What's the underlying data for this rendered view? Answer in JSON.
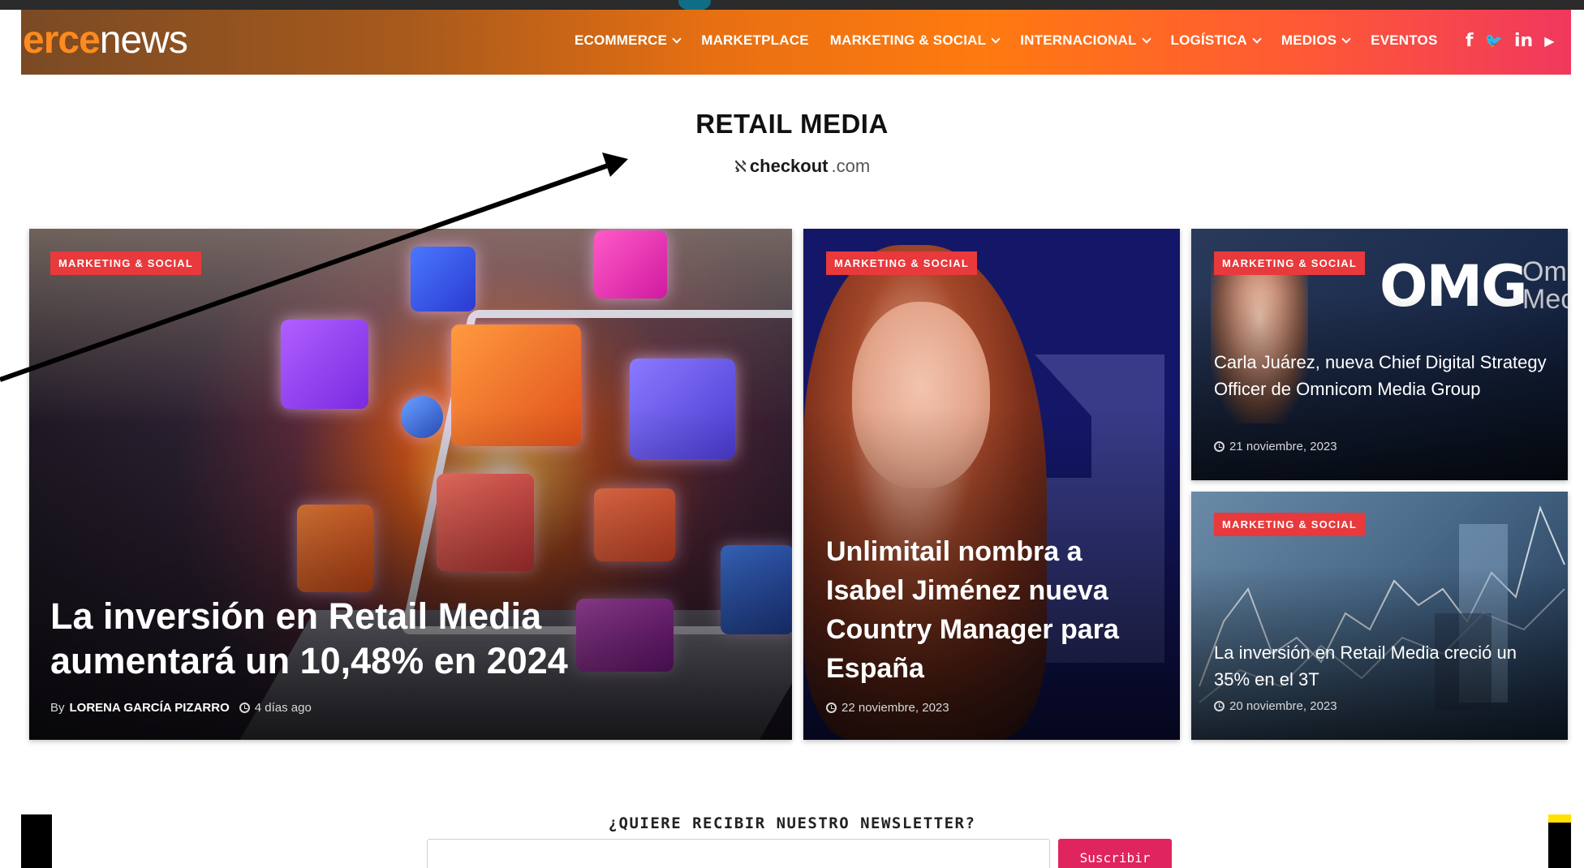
{
  "header": {
    "logo_part1": "erce",
    "logo_part2": "news",
    "nav": [
      {
        "label": "ECOMMERCE",
        "has_dropdown": true
      },
      {
        "label": "MARKETPLACE",
        "has_dropdown": false
      },
      {
        "label": "MARKETING & SOCIAL",
        "has_dropdown": true
      },
      {
        "label": "INTERNACIONAL",
        "has_dropdown": true
      },
      {
        "label": "LOGÍSTICA",
        "has_dropdown": true
      },
      {
        "label": "MEDIOS",
        "has_dropdown": true
      },
      {
        "label": "EVENTOS",
        "has_dropdown": false
      }
    ],
    "social_icons": [
      "facebook-icon",
      "twitter-icon",
      "linkedin-icon",
      "youtube-icon"
    ],
    "social_glyphs": [
      "f",
      "🐦",
      "in",
      "▶"
    ]
  },
  "section": {
    "title": "RETAIL MEDIA",
    "sponsor_brand": "checkout",
    "sponsor_domain": ".com"
  },
  "articles": [
    {
      "category": "MARKETING & SOCIAL",
      "title": "La inversión en Retail Media aumentará un 10,48% en 2024",
      "by_prefix": "By",
      "author": "LORENA GARCÍA PIZARRO",
      "date": "4 días ago"
    },
    {
      "category": "MARKETING & SOCIAL",
      "title": "Unlimitail nombra a Isabel Jiménez nueva Country Manager para España",
      "date": "22 noviembre, 2023"
    },
    {
      "category": "MARKETING & SOCIAL",
      "title": "Carla Juárez, nueva Chief Digital Strategy Officer de Omnicom Media Group",
      "date": "21 noviembre, 2023",
      "image_logo": "OMG",
      "image_logo_side": "Om Mec"
    },
    {
      "category": "MARKETING & SOCIAL",
      "title": "La inversión en Retail Media creció un 35% en el 3T",
      "date": "20 noviembre, 2023"
    }
  ],
  "newsletter": {
    "title": "¿QUIERE RECIBIR NUESTRO NEWSLETTER?",
    "input_placeholder": "",
    "button_label": "Suscribir"
  },
  "colors": {
    "badge": "#e8393c",
    "subscribe_button": "#e0245e",
    "header_gradient_start": "#7a4a24",
    "header_gradient_end": "#f0385e"
  }
}
